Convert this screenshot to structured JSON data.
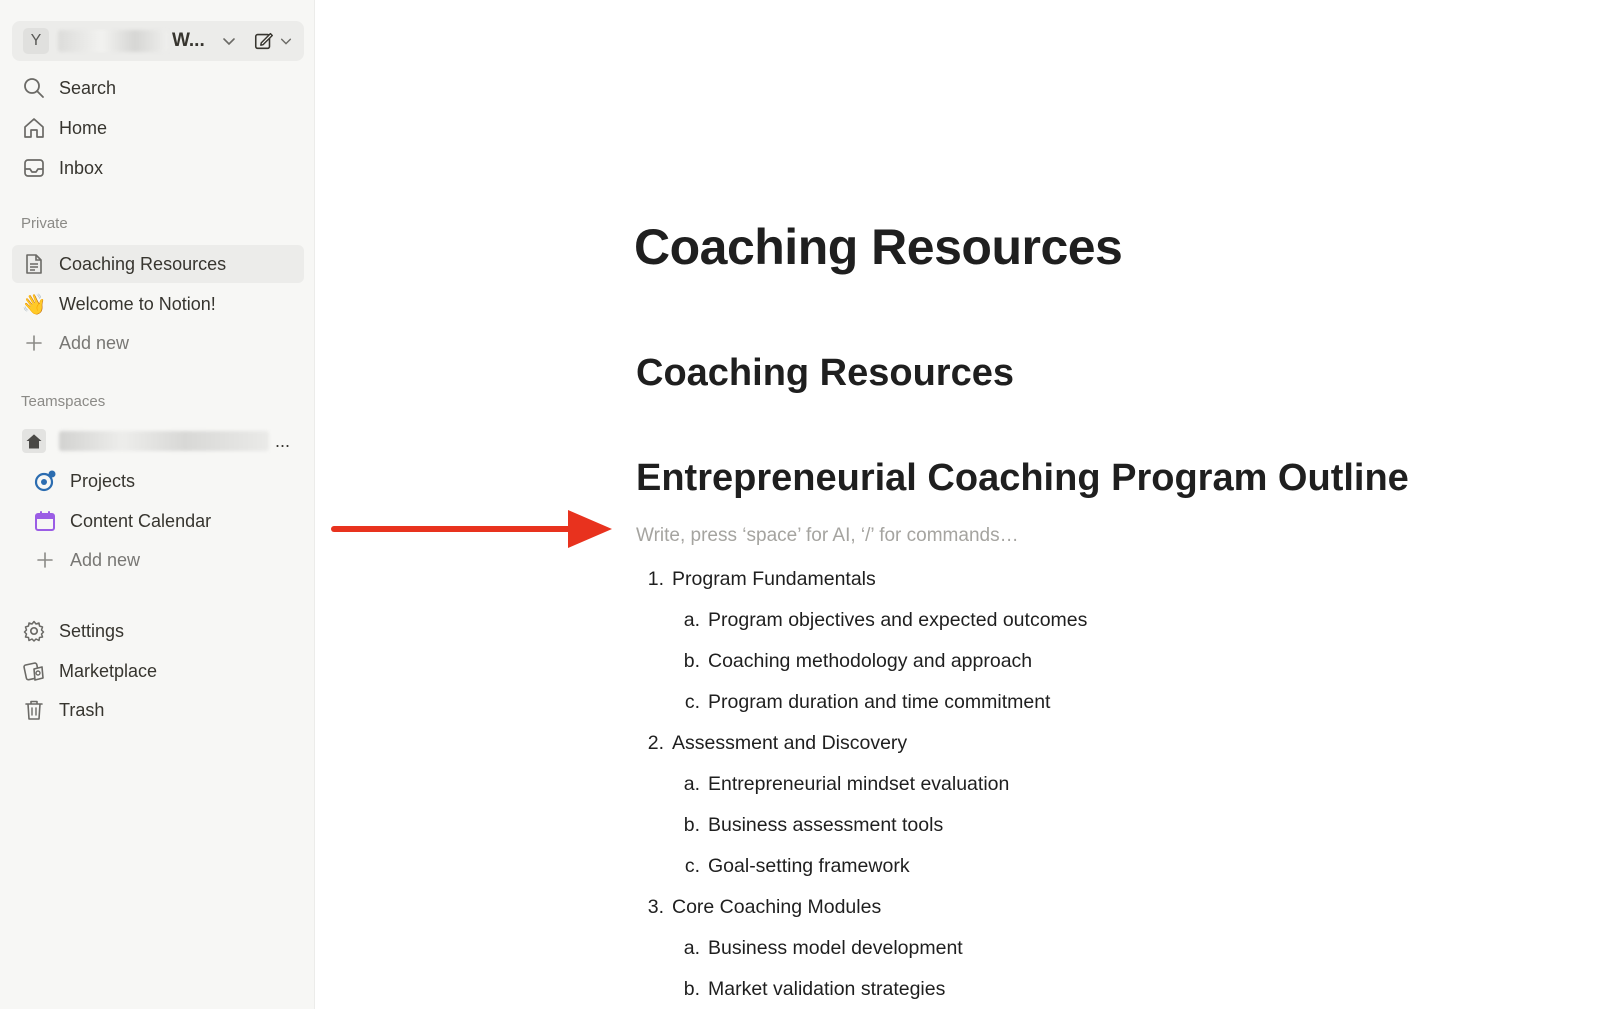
{
  "workspace": {
    "avatar_letter": "Y",
    "name_suffix": "W..."
  },
  "sidebar": {
    "top_items": [
      {
        "label": "Search",
        "icon": "search-icon"
      },
      {
        "label": "Home",
        "icon": "home-icon"
      },
      {
        "label": "Inbox",
        "icon": "inbox-icon"
      }
    ],
    "private_label": "Private",
    "private_items": [
      {
        "label": "Coaching Resources",
        "icon": "page-icon",
        "active": true
      },
      {
        "label": "Welcome to Notion!",
        "icon": "waving-hand-icon",
        "emoji": "👋"
      },
      {
        "label": "Add new",
        "icon": "plus-icon"
      }
    ],
    "teamspaces_label": "Teamspaces",
    "teamspace": {
      "ellipsis": "...",
      "icon": "house-icon"
    },
    "team_items": [
      {
        "label": "Projects",
        "icon": "projects-icon"
      },
      {
        "label": "Content Calendar",
        "icon": "calendar-icon"
      },
      {
        "label": "Add new",
        "icon": "plus-icon"
      }
    ],
    "bottom_items": [
      {
        "label": "Settings",
        "icon": "gear-icon"
      },
      {
        "label": "Marketplace",
        "icon": "marketplace-icon"
      },
      {
        "label": "Trash",
        "icon": "trash-icon"
      }
    ]
  },
  "page": {
    "title": "Coaching Resources",
    "heading2": "Coaching Resources",
    "heading1": "Entrepreneurial Coaching Program Outline",
    "placeholder": "Write, press ‘space’ for AI, ‘/’ for commands…",
    "outline": [
      {
        "marker": "1.",
        "text": "Program Fundamentals",
        "level": 1
      },
      {
        "marker": "a.",
        "text": "Program objectives and expected outcomes",
        "level": 2
      },
      {
        "marker": "b.",
        "text": "Coaching methodology and approach",
        "level": 2
      },
      {
        "marker": "c.",
        "text": "Program duration and time commitment",
        "level": 2
      },
      {
        "marker": "2.",
        "text": "Assessment and Discovery",
        "level": 1
      },
      {
        "marker": "a.",
        "text": "Entrepreneurial mindset evaluation",
        "level": 2
      },
      {
        "marker": "b.",
        "text": "Business assessment tools",
        "level": 2
      },
      {
        "marker": "c.",
        "text": "Goal-setting framework",
        "level": 2
      },
      {
        "marker": "3.",
        "text": "Core Coaching Modules",
        "level": 1
      },
      {
        "marker": "a.",
        "text": "Business model development",
        "level": 2
      },
      {
        "marker": "b.",
        "text": "Market validation strategies",
        "level": 2
      }
    ]
  },
  "colors": {
    "annotation_arrow": "#e8321e",
    "sidebar_bg": "#f7f7f5",
    "calendar_accent": "#9b5de5",
    "projects_accent": "#2b6cb0"
  }
}
